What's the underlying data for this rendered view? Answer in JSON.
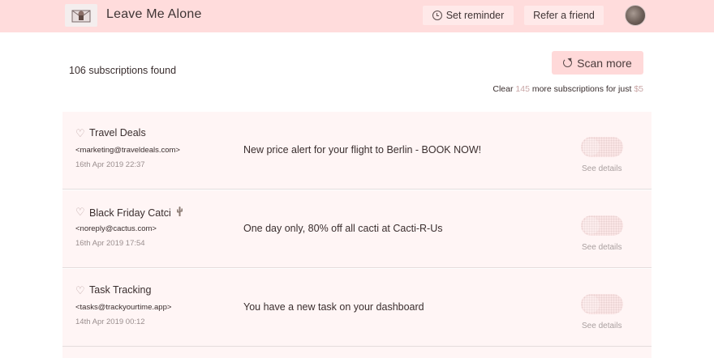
{
  "header": {
    "title": "Leave Me Alone",
    "set_reminder": "Set reminder",
    "refer_friend": "Refer a friend"
  },
  "summary": {
    "found": "106 subscriptions found",
    "scan_more": "Scan more",
    "clear_prefix": "Clear ",
    "clear_count": "145",
    "clear_middle": " more subscriptions for just ",
    "clear_price": "$5"
  },
  "subscriptions": [
    {
      "name": "Travel Deals",
      "email": "<marketing@traveldeals.com>",
      "date": "16th Apr 2019 22:37",
      "subject": "New price alert for your flight to Berlin - BOOK NOW!",
      "see_details": "See details",
      "has_cactus": false
    },
    {
      "name": "Black Friday Catci",
      "email": "<noreply@cactus.com>",
      "date": "16th Apr 2019 17:54",
      "subject": "One day only, 80% off all cacti at Cacti-R-Us",
      "see_details": "See details",
      "has_cactus": true
    },
    {
      "name": "Task Tracking",
      "email": "<tasks@trackyourtime.app>",
      "date": "14th Apr 2019 00:12",
      "subject": "You have a new task on your dashboard",
      "see_details": "See details",
      "has_cactus": false
    }
  ],
  "colors": {
    "header_bg": "#ffdcdc",
    "row_bg": "#fff5f5",
    "accent": "#c9a6a6"
  },
  "icons": {
    "logo": "envelope-logo-icon",
    "reminder": "clock-icon",
    "scan": "refresh-icon",
    "favorite": "heart-icon",
    "cactus": "cactus-icon"
  }
}
